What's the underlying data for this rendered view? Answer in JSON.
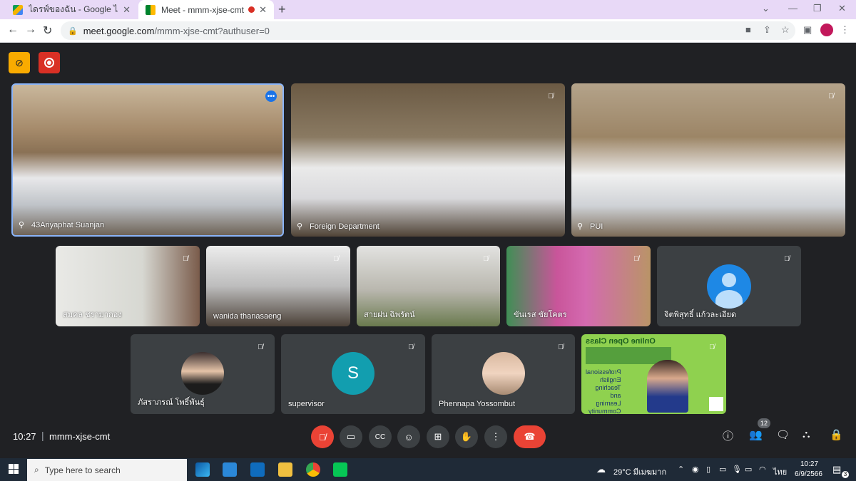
{
  "browser": {
    "tabs": [
      {
        "title": "ไดรฟ์ของฉัน - Google ไดรฟ์",
        "favicon": "google-drive-icon"
      },
      {
        "title": "Meet - mmm-xjse-cmt",
        "favicon": "google-meet-icon",
        "recording": true
      }
    ],
    "new_tab": "+",
    "url_host": "meet.google.com",
    "url_path": "/mmm-xjse-cmt?authuser=0"
  },
  "meeting": {
    "time": "10:27",
    "code": "mmm-xjse-cmt",
    "people_count": "12"
  },
  "tiles": [
    {
      "name": "43Ariyaphat Suanjan",
      "pinned": true,
      "active": true
    },
    {
      "name": "Foreign Department",
      "pinned": true
    },
    {
      "name": "PUI",
      "pinned": true
    },
    {
      "name": "สมคล ชรามากอง"
    },
    {
      "name": "wanida thanasaeng"
    },
    {
      "name": "สายฝน ฉิพรัตน์"
    },
    {
      "name": "ขันเรส ชัยโคตร"
    },
    {
      "name": "จิตพิสุทธิ์ แก้วละเอียด",
      "avatar": "person"
    },
    {
      "name": "ภัสราภรณ์ โพธิ์พันธุ์"
    },
    {
      "name": "supervisor",
      "avatar_letter": "S"
    },
    {
      "name": "Phennapa Yossombut"
    },
    {
      "name": "Online Open Class"
    }
  ],
  "presentation": {
    "title": "Online Open Class",
    "lines": [
      "Professional",
      "English",
      "Teaching",
      "and",
      "Learning",
      "Community"
    ]
  },
  "taskbar": {
    "search_placeholder": "Type here to search",
    "weather": "29°C มีเมฆมาก",
    "lang": "ไทย",
    "clock_time": "10:27",
    "clock_date": "6/9/2566",
    "notif_count": "3"
  },
  "colors": {
    "meet_bg": "#202124",
    "end_call": "#ea4335",
    "mute_red": "#ea4335",
    "accent_blue": "#8ab4f8",
    "tabbar": "#e8d9f7",
    "supervisor_avatar": "#129eaf"
  }
}
